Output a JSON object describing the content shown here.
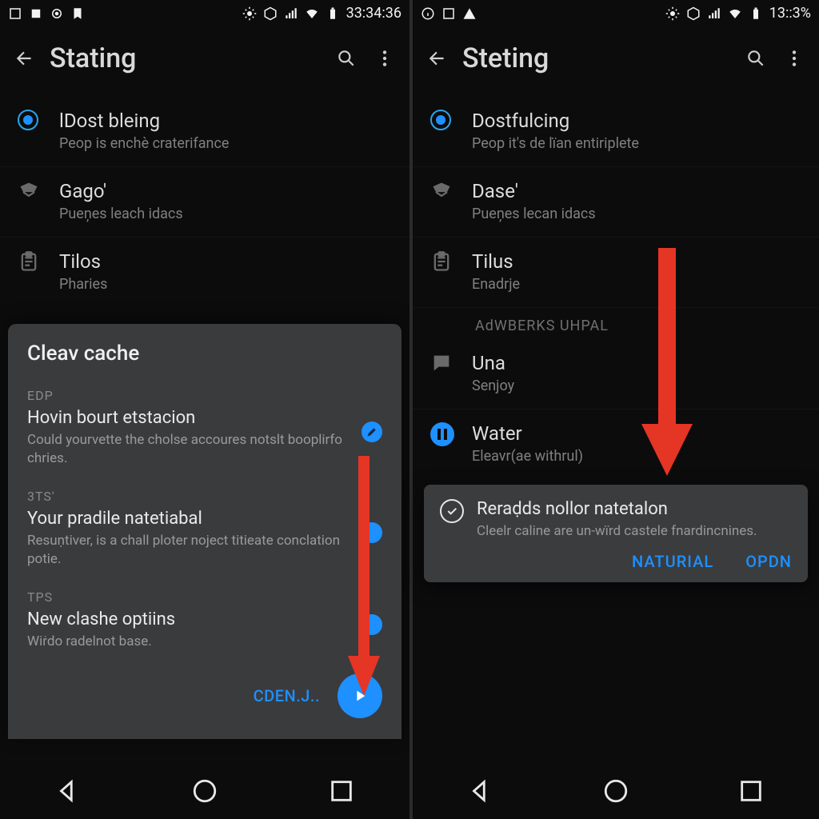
{
  "left": {
    "statusbar": {
      "time": "33:34:36"
    },
    "title": "Stating",
    "items": [
      {
        "name": "item-dost",
        "primary": "lDost bleing",
        "secondary": "Peop is enchè craterifance",
        "radio": true
      },
      {
        "name": "item-gago",
        "primary": "Gago'",
        "secondary": "Pueņes leach idacs"
      },
      {
        "name": "item-tilos",
        "primary": "Tilos",
        "secondary": "Pharies"
      }
    ],
    "sheet": {
      "title": "Cleav cache",
      "rows": [
        {
          "tag": "EDP",
          "title": "Hovin bourt etstacion",
          "desc": "Could yourvette the cholse accoures notslt booplirfo chries.",
          "edit": true
        },
        {
          "tag": "3TS'",
          "title": "Your pradile natetiabal",
          "desc": "Resuṇtiver, is a chall ploter noject titieate conclation potie."
        },
        {
          "tag": "TPS",
          "title": "New clashe optiins",
          "desc": "Wiṙdo radelnot base."
        }
      ],
      "actionLabel": "CDEN.J.."
    }
  },
  "right": {
    "statusbar": {
      "time": "13::3%"
    },
    "title": "Steting",
    "items": [
      {
        "name": "item-dostf",
        "primary": "Dostfulcing",
        "secondary": "Peop it's de lïan entiriplete",
        "radio": true
      },
      {
        "name": "item-dase",
        "primary": "Dase'",
        "secondary": "Pueņes lecan idacs"
      },
      {
        "name": "item-tilus",
        "primary": "Tilus",
        "secondary": "Enadrje"
      }
    ],
    "sectionHeader": "AdWBERKS UHPAL",
    "moreItems": [
      {
        "name": "item-una",
        "primary": "Una",
        "secondary": "Senjoy"
      },
      {
        "name": "item-water",
        "primary": "Water",
        "secondary": "Eleavr(ae withrul)",
        "pause": true
      }
    ],
    "snackbar": {
      "title": "Reraḍds nollor natetalon",
      "desc": "Cleelr caline are un-wïrd castele fnardincnines.",
      "actions": [
        "NATURIAL",
        "OPDN"
      ]
    }
  }
}
